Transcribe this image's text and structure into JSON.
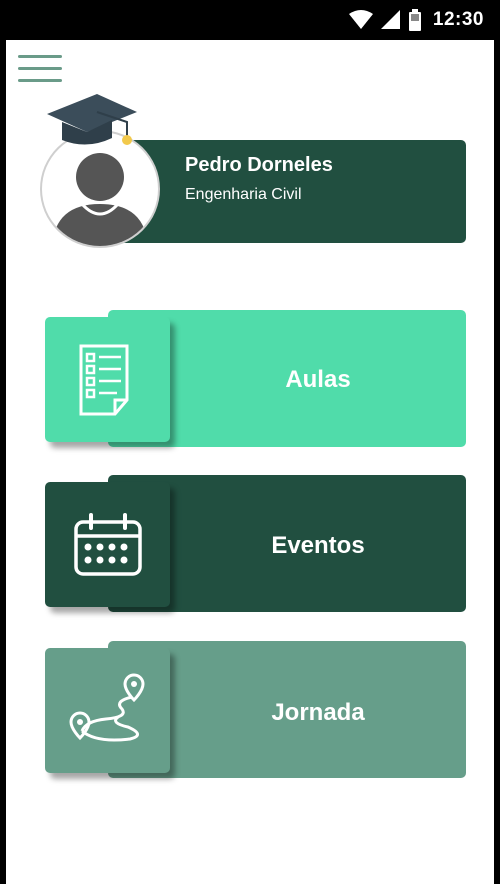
{
  "status_bar": {
    "time": "12:30",
    "icons": [
      "wifi-icon",
      "signal-icon",
      "battery-icon"
    ]
  },
  "header": {
    "menu_icon": "hamburger-menu-icon"
  },
  "profile": {
    "name": "Pedro Dorneles",
    "course": "Engenharia Civil",
    "avatar_icon": "user-avatar-icon",
    "badge_icon": "graduation-cap-icon"
  },
  "menu": [
    {
      "label": "Aulas",
      "icon": "checklist-document-icon",
      "color": "#50dcaa",
      "icon_bg": "#50dcaa"
    },
    {
      "label": "Eventos",
      "icon": "calendar-icon",
      "color": "#214f40",
      "icon_bg": "#214f40"
    },
    {
      "label": "Jornada",
      "icon": "route-map-icon",
      "color": "#669e8a",
      "icon_bg": "#669e8a"
    }
  ],
  "colors": {
    "dark_green": "#214f40",
    "mint": "#50dcaa",
    "sage": "#669e8a",
    "accent_yellow": "#f2c94c"
  }
}
